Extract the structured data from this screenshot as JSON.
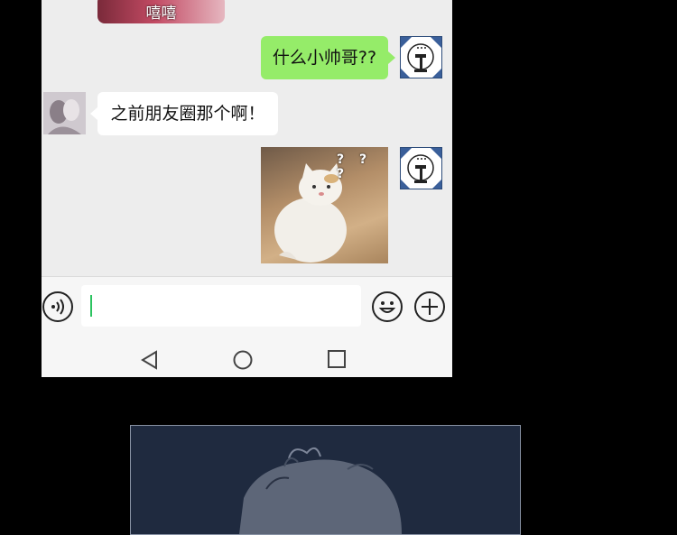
{
  "chat": {
    "top_sticker_text": "嘻嘻",
    "messages": [
      {
        "side": "right",
        "type": "text",
        "text": "什么小帅哥??"
      },
      {
        "side": "left",
        "type": "text",
        "text": "之前朋友圈那个啊！"
      },
      {
        "side": "right",
        "type": "image",
        "image_text": "? ? ?"
      }
    ]
  },
  "input_bar": {
    "value": ""
  },
  "colors": {
    "sent_bubble": "#95ec69",
    "received_bubble": "#ffffff",
    "caret": "#2bc35f",
    "chat_bg": "#ededed"
  },
  "icons": [
    "voice-icon",
    "emoji-icon",
    "plus-icon",
    "back-icon",
    "home-icon",
    "recent-apps-icon"
  ]
}
